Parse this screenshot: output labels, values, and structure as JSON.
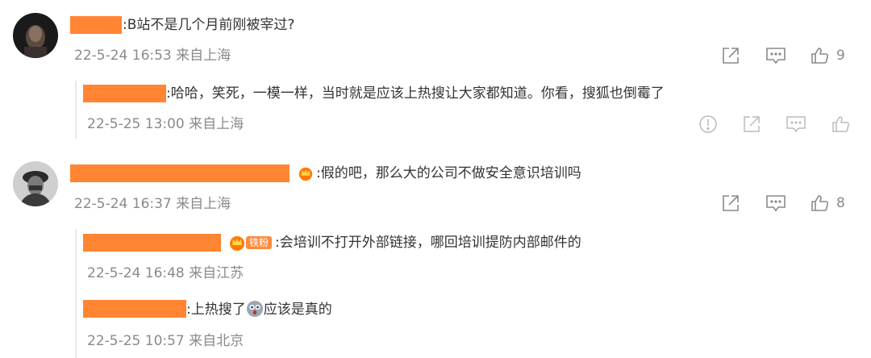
{
  "colors": {
    "redaction": "#ff8533",
    "meta_text": "#8a8a8a",
    "body_text": "#333333",
    "thread_bar": "#e8e8e8"
  },
  "comments": [
    {
      "text": ":B站不是几个月前刚被宰过?",
      "meta": "22-5-24 16:53 来自上海",
      "like_count": "9",
      "replies": [
        {
          "text": ":哈哈，笑死，一模一样，当时就是应该上热搜让大家都知道。你看，搜狐也倒霉了",
          "meta": "22-5-25 13:00 来自上海"
        }
      ]
    },
    {
      "text": ":假的吧，那么大的公司不做安全意识培训吗",
      "meta": "22-5-24 16:37 来自上海",
      "like_count": "8",
      "replies": [
        {
          "fan_badge": "铁粉",
          "text": ":会培训不打开外部链接，哪回培训提防内部邮件的",
          "meta": "22-5-24 16:48 来自江苏"
        },
        {
          "text_before": ":上热搜了",
          "text_after": "应该是真的",
          "meta": "22-5-25 10:57 来自北京"
        }
      ]
    }
  ],
  "icons": [
    "share-icon",
    "comment-icon",
    "like-icon",
    "report-icon",
    "crown-icon",
    "surprised-emoji-icon"
  ]
}
